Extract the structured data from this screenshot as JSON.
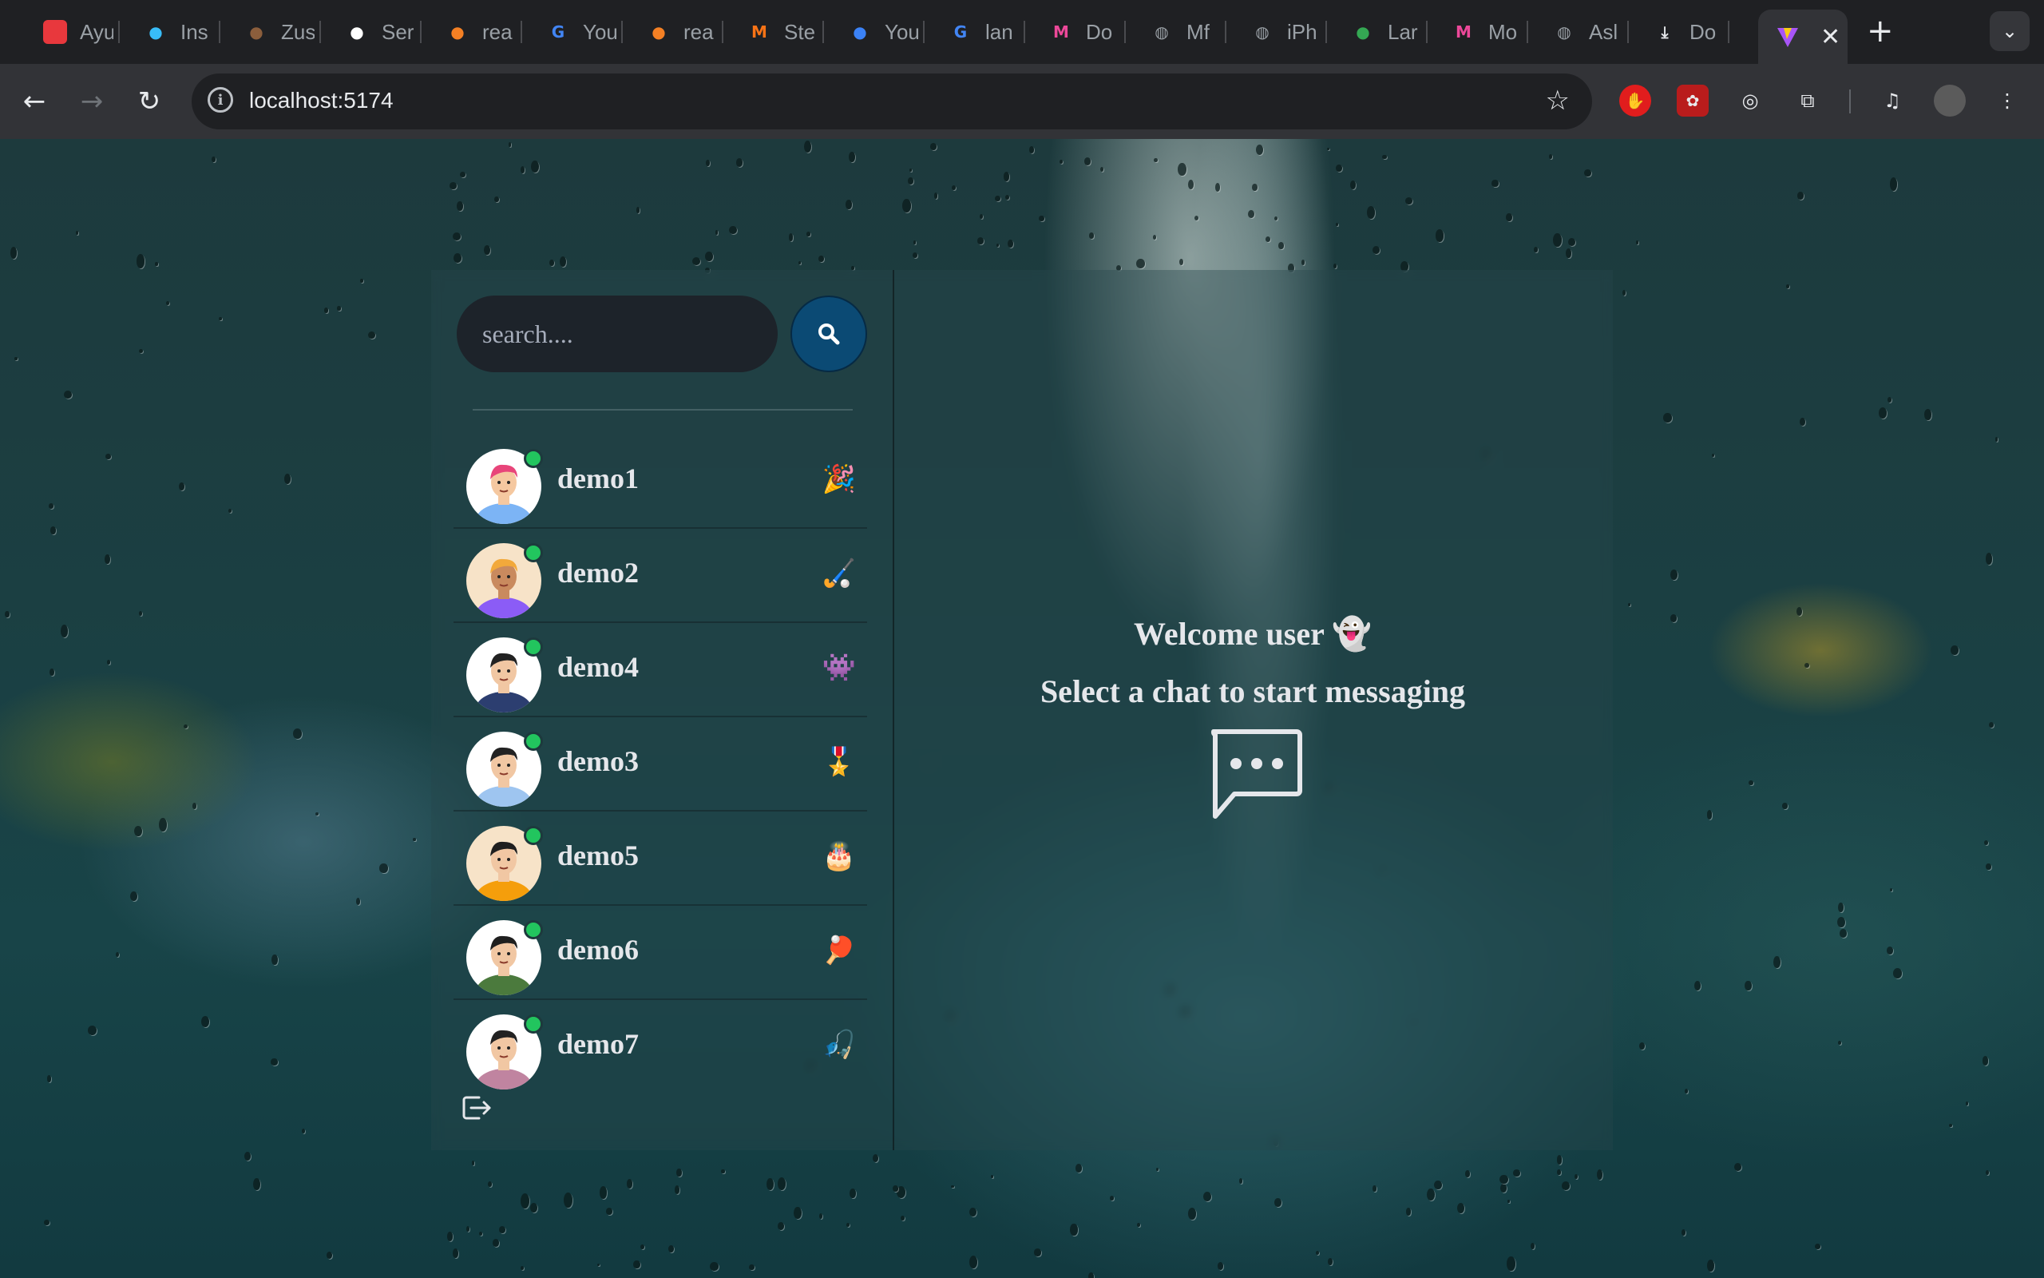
{
  "browser": {
    "tabs": [
      {
        "title": "Ayu",
        "icon": "h-icon",
        "color": "#e8383d"
      },
      {
        "title": "Ins",
        "icon": "tailwind-icon",
        "color": "#38bdf8"
      },
      {
        "title": "Zus",
        "icon": "bear-icon",
        "color": "#8b5e3c"
      },
      {
        "title": "Ser",
        "icon": "openai-icon",
        "color": "#ffffff"
      },
      {
        "title": "rea",
        "icon": "stackoverflow-icon",
        "color": "#f48024"
      },
      {
        "title": "You",
        "icon": "google-icon",
        "color": "#4285f4"
      },
      {
        "title": "rea",
        "icon": "stackoverflow-icon",
        "color": "#f48024"
      },
      {
        "title": "Ste",
        "icon": "m-icon",
        "color": "#f97316"
      },
      {
        "title": "You",
        "icon": "figma-flower-icon",
        "color": "#3b82f6"
      },
      {
        "title": "lan",
        "icon": "google-icon",
        "color": "#4285f4"
      },
      {
        "title": "Do",
        "icon": "m-logo-icon",
        "color": "#ec4899"
      },
      {
        "title": "Mf",
        "icon": "globe-icon",
        "color": "#9aa0a6"
      },
      {
        "title": "iPh",
        "icon": "globe-icon",
        "color": "#9aa0a6"
      },
      {
        "title": "Lar",
        "icon": "drive-icon",
        "color": "#34a853"
      },
      {
        "title": "Mo",
        "icon": "m-logo-icon",
        "color": "#ec4899"
      },
      {
        "title": "Asl",
        "icon": "globe-icon",
        "color": "#9aa0a6"
      },
      {
        "title": "Do",
        "icon": "download-icon",
        "color": "#e8eaed"
      }
    ],
    "active_tab_icon": "vite-icon",
    "url": "localhost:5174"
  },
  "app": {
    "search_placeholder": "search....",
    "conversations": [
      {
        "name": "demo1",
        "emoji": "🎉",
        "online": true
      },
      {
        "name": "demo2",
        "emoji": "🏑",
        "online": true
      },
      {
        "name": "demo4",
        "emoji": "👾",
        "online": true
      },
      {
        "name": "demo3",
        "emoji": "🎖️",
        "online": true
      },
      {
        "name": "demo5",
        "emoji": "🎂",
        "online": true
      },
      {
        "name": "demo6",
        "emoji": "🏓",
        "online": true
      },
      {
        "name": "demo7",
        "emoji": "🎣",
        "online": true
      }
    ],
    "welcome_line": "Welcome user 👻",
    "select_line": "Select a chat to start messaging"
  },
  "colors": {
    "search_button": "#0b4a74",
    "online_dot": "#22c55e",
    "input_bg": "#1d232a"
  }
}
